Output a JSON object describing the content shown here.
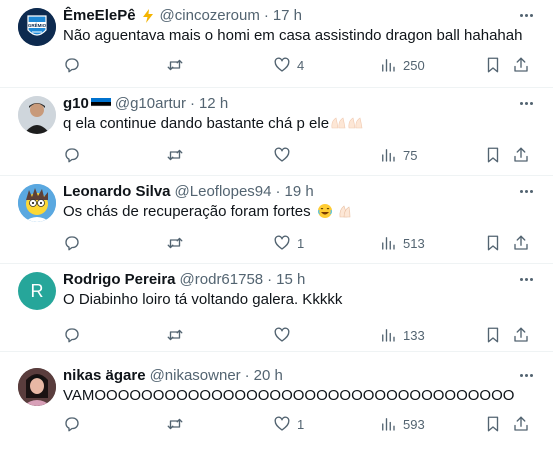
{
  "tweets": [
    {
      "name": "ÊmeElePê",
      "handle": "@cincozeroum",
      "time": "17 h",
      "text": "Não aguentava mais o homi em casa assistindo dragon ball hahahah",
      "replies": "",
      "retweets": "",
      "likes": "4",
      "views": "250",
      "avatar_label": "GRÊMIO"
    },
    {
      "name": "g10",
      "handle": "@g10artur",
      "time": "12 h",
      "text": "q ela continue dando bastante chá p ele",
      "replies": "",
      "retweets": "",
      "likes": "",
      "views": "75",
      "avatar_label": ""
    },
    {
      "name": "Leonardo Silva",
      "handle": "@Leoflopes94",
      "time": "19 h",
      "text": "Os chás de recuperação foram fortes",
      "replies": "",
      "retweets": "",
      "likes": "1",
      "views": "513",
      "avatar_label": ""
    },
    {
      "name": "Rodrigo Pereira",
      "handle": "@rodr61758",
      "time": "15 h",
      "text": "O Diabinho loiro tá voltando galera. Kkkkk",
      "replies": "",
      "retweets": "",
      "likes": "",
      "views": "133",
      "avatar_label": "R"
    },
    {
      "name": "nikas ägare",
      "handle": "@nikasowner",
      "time": "20 h",
      "text": "VAMOOOOOOOOOOOOOOOOOOOOOOOOOOOOOOOOOOOO",
      "replies": "",
      "retweets": "",
      "likes": "1",
      "views": "593",
      "avatar_label": ""
    }
  ],
  "colors": {
    "text": "#0f1419",
    "muted": "#536471",
    "divider": "#eff3f4",
    "avatar_r": "#26a69a"
  },
  "icons": [
    "more-icon",
    "reply-icon",
    "retweet-icon",
    "like-icon",
    "views-icon",
    "bookmark-icon",
    "share-icon",
    "lightning-icon",
    "flag-icon",
    "emoji-icon"
  ]
}
